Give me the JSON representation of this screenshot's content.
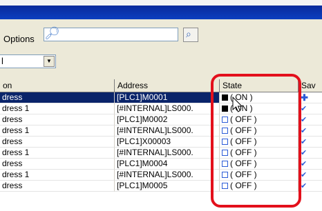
{
  "toolbar": {
    "options_label": "Options",
    "select_value": "l"
  },
  "table": {
    "columns": [
      "on",
      "Address",
      "State",
      "Sav"
    ],
    "rows": [
      {
        "name": "dress",
        "address": "[PLC1]M0001",
        "state": "( ON )",
        "on": true,
        "selected": true
      },
      {
        "name": "dress 1",
        "address": "[#INTERNAL]LS000.",
        "state": "( ON )",
        "on": true,
        "selected": false
      },
      {
        "name": "dress",
        "address": "[PLC1]M0002",
        "state": "( OFF )",
        "on": false,
        "selected": false
      },
      {
        "name": "dress 1",
        "address": "[#INTERNAL]LS000.",
        "state": "( OFF )",
        "on": false,
        "selected": false
      },
      {
        "name": "dress",
        "address": "[PLC1]X00003",
        "state": "( OFF )",
        "on": false,
        "selected": false
      },
      {
        "name": "dress 1",
        "address": "[#INTERNAL]LS000.",
        "state": "( OFF )",
        "on": false,
        "selected": false
      },
      {
        "name": "dress",
        "address": "[PLC1]M0004",
        "state": "( OFF )",
        "on": false,
        "selected": false
      },
      {
        "name": "dress 1",
        "address": "[#INTERNAL]LS000.",
        "state": "( OFF )",
        "on": false,
        "selected": false
      },
      {
        "name": "dress",
        "address": "[PLC1]M0005",
        "state": "( OFF )",
        "on": false,
        "selected": false
      }
    ]
  },
  "colors": {
    "selection": "#0a246a",
    "highlight": "#e3101c",
    "titlebar": "#0c3fbf"
  }
}
